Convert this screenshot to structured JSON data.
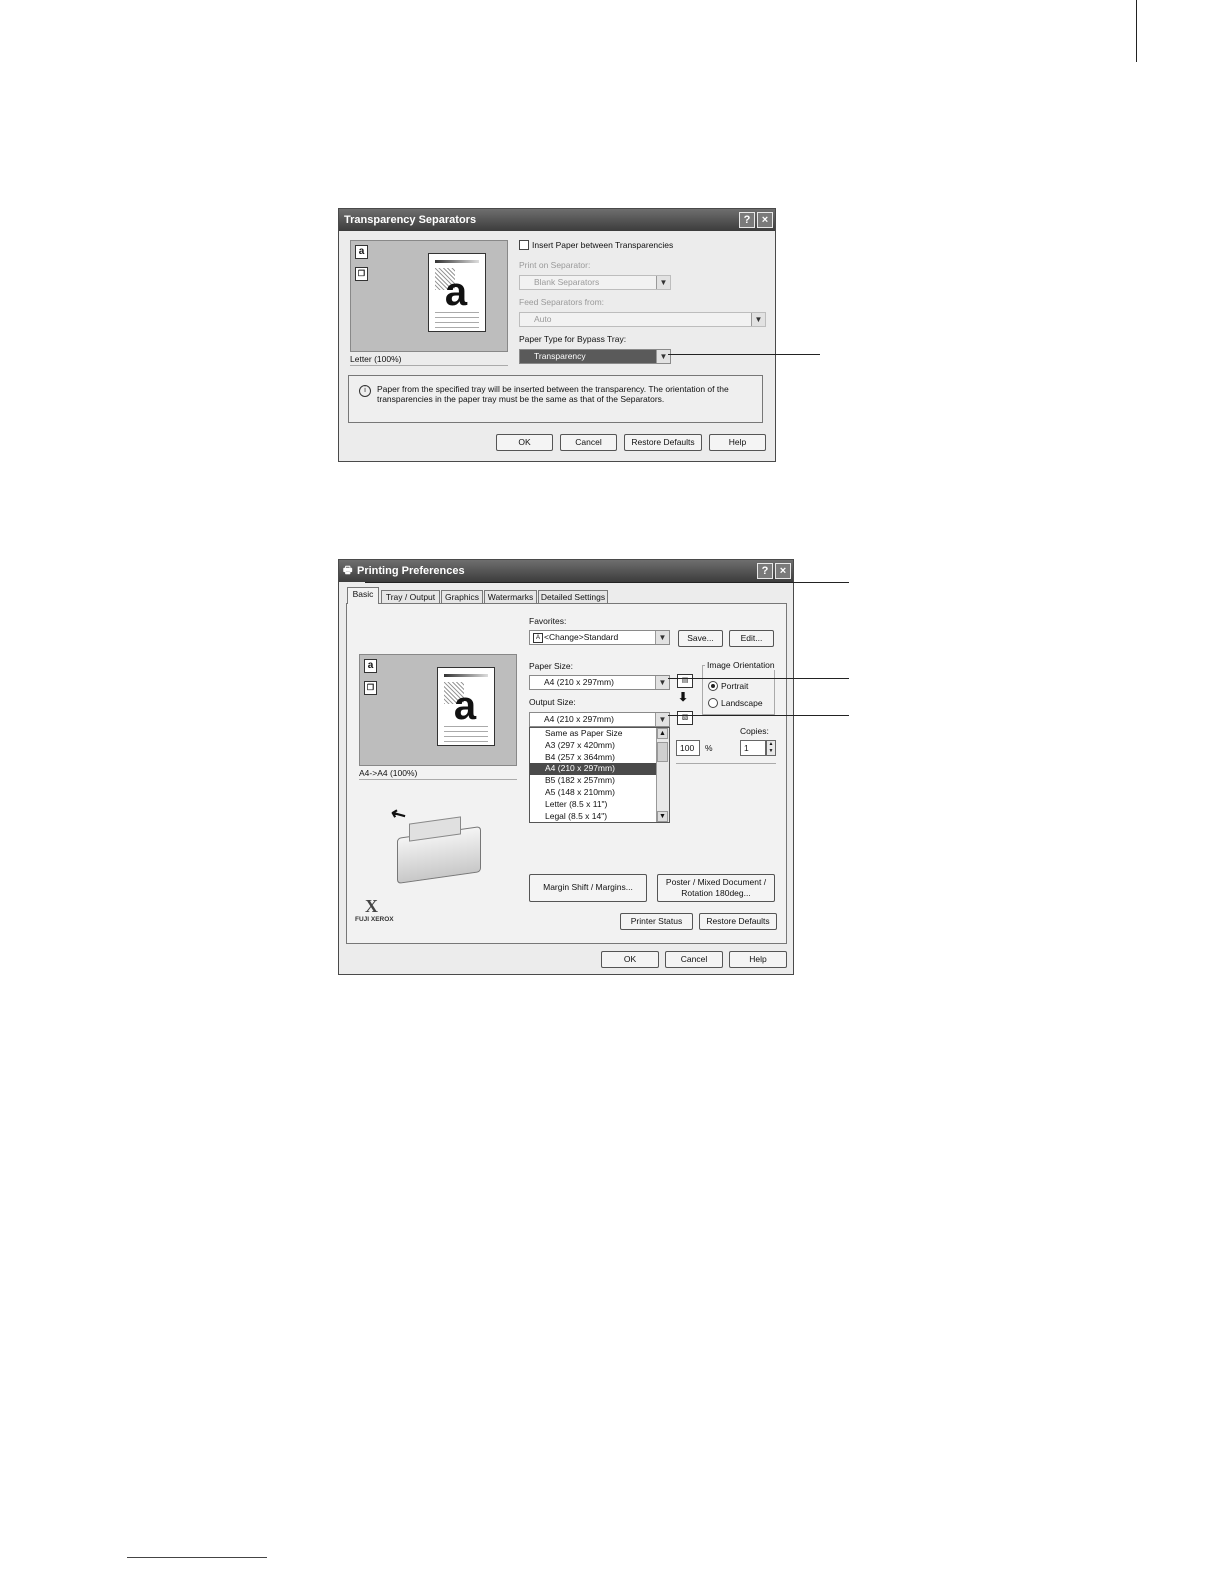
{
  "dialog1": {
    "title": "Transparency Separators",
    "help_btn": "?",
    "close_btn": "×",
    "preview_caption": "Letter (100%)",
    "preview_letter": "a",
    "icon_letter": "a",
    "insert_label": "Insert Paper between Transparencies",
    "print_on_label": "Print on Separator:",
    "print_on_value": "Blank Separators",
    "feed_label": "Feed Separators from:",
    "feed_value": "Auto",
    "paper_type_label": "Paper Type for Bypass Tray:",
    "paper_type_value": "Transparency",
    "info_icon": "i",
    "info_text": "Paper from the specified tray will be inserted between the transparency. The orientation of the transparencies in the paper tray must be the same as that of the Separators.",
    "buttons": {
      "ok": "OK",
      "cancel": "Cancel",
      "restore": "Restore Defaults",
      "help": "Help"
    }
  },
  "dialog2": {
    "title": "Printing Preferences",
    "help_btn": "?",
    "close_btn": "×",
    "tabs": [
      "Basic",
      "Tray / Output",
      "Graphics",
      "Watermarks",
      "Detailed Settings"
    ],
    "preview_caption": "A4->A4 (100%)",
    "preview_letter": "a",
    "icon_letter": "a",
    "favorites_label": "Favorites:",
    "favorites_value": "<Change>Standard",
    "favorites_icon": "A",
    "save_btn": "Save...",
    "edit_btn": "Edit...",
    "paper_size_label": "Paper Size:",
    "paper_size_value": "A4 (210 x 297mm)",
    "output_size_label": "Output Size:",
    "output_size_value": "A4 (210 x 297mm)",
    "output_options": [
      "Same as Paper Size",
      "A3 (297 x 420mm)",
      "B4 (257 x 364mm)",
      "A4 (210 x 297mm)",
      "B5 (182 x 257mm)",
      "A5 (148 x 210mm)",
      "Letter (8.5 x 11\")",
      "Legal (8.5 x 14\")"
    ],
    "output_selected_index": 3,
    "orientation_label": "Image Orientation",
    "portrait_label": "Portrait",
    "landscape_label": "Landscape",
    "zoom_value": "100",
    "zoom_unit": "%",
    "copies_label": "Copies:",
    "copies_value": "1",
    "margin_btn": "Margin Shift / Margins...",
    "poster_btn": "Poster / Mixed Document / Rotation 180deg...",
    "printer_status_btn": "Printer Status",
    "restore_btn": "Restore Defaults",
    "brand_mark": "X",
    "brand_text": "FUJI XEROX",
    "buttons": {
      "ok": "OK",
      "cancel": "Cancel",
      "help": "Help"
    }
  }
}
